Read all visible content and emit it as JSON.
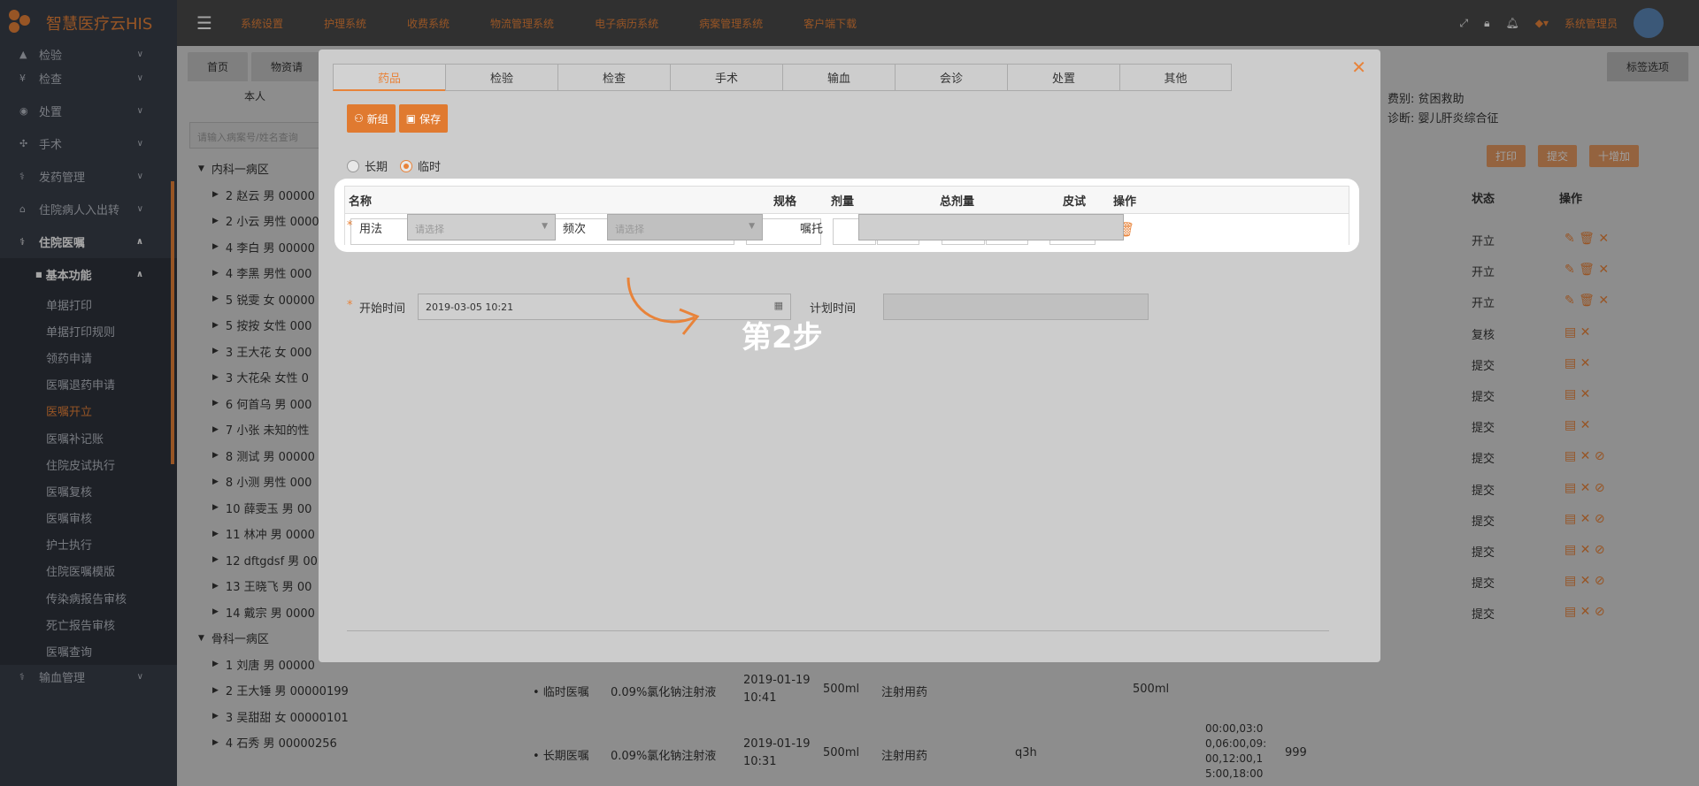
{
  "app": {
    "title": "智慧医疗云HIS"
  },
  "topnav": [
    "系统设置",
    "护理系统",
    "收费系统",
    "物流管理系统",
    "电子病历系统",
    "病案管理系统",
    "客户端下载"
  ],
  "user": {
    "name": "系统管理员"
  },
  "sidebar": {
    "items": [
      {
        "label": "检验"
      },
      {
        "label": "检查"
      },
      {
        "label": "处置"
      },
      {
        "label": "手术"
      },
      {
        "label": "发药管理"
      },
      {
        "label": "住院病人入出转"
      },
      {
        "label": "住院医嘱"
      }
    ],
    "group": "基本功能",
    "subitems": [
      "单据打印",
      "单据打印规则",
      "领药申请",
      "医嘱退药申请",
      "医嘱开立",
      "医嘱补记账",
      "住院皮试执行",
      "医嘱复核",
      "医嘱审核",
      "护士执行",
      "住院医嘱模版",
      "传染病报告审核",
      "死亡报告审核",
      "医嘱查询"
    ],
    "footer": "输血管理"
  },
  "bg": {
    "tabs": [
      "首页",
      "物资请"
    ],
    "tab_options": "标签选项",
    "self_label": "本人",
    "search_placeholder": "请输入病案号/姓名查询",
    "tree": [
      {
        "label": "内科一病区",
        "head": true
      },
      {
        "label": "2 赵云 男 00000"
      },
      {
        "label": "2 小云 男性 0000"
      },
      {
        "label": "4 李白 男 00000"
      },
      {
        "label": "4 李黑 男性 000"
      },
      {
        "label": "5 锐雯 女 00000"
      },
      {
        "label": "5 按按 女性 000"
      },
      {
        "label": "3 王大花 女 000"
      },
      {
        "label": "3 大花朵 女性 0"
      },
      {
        "label": "6 何首乌 男 000"
      },
      {
        "label": "7 小张 未知的性"
      },
      {
        "label": "8 测试 男 00000"
      },
      {
        "label": "8 小测 男性 000"
      },
      {
        "label": "10 薛雯玉 男 00"
      },
      {
        "label": "11 林冲 男 0000"
      },
      {
        "label": "12 dftgdsf 男 00"
      },
      {
        "label": "13 王晓飞 男 00"
      },
      {
        "label": "14 戴宗 男 0000"
      },
      {
        "label": "骨科一病区",
        "head": true
      },
      {
        "label": "1 刘唐 男 00000"
      },
      {
        "label": "2 王大锤 男 00000199"
      },
      {
        "label": "3 吴甜甜 女 00000101"
      },
      {
        "label": "4 石秀 男 00000256"
      }
    ],
    "info": {
      "fee_type": "费别: 贫困救助",
      "diagnosis": "诊断: 婴儿肝炎综合征"
    },
    "actions": [
      "打印",
      "提交",
      "十增加"
    ],
    "col_status": "状态",
    "col_ops": "操作",
    "statuses": [
      "开立",
      "开立",
      "开立",
      "复核",
      "提交",
      "提交",
      "提交",
      "提交",
      "提交",
      "提交",
      "提交",
      "提交",
      "提交"
    ],
    "row_a": {
      "type": "• 临时医嘱",
      "drug": "0.09%氯化钠注射液",
      "date": "2019-01-19",
      "time": "10:41",
      "amount": "500ml",
      "usage": "注射用药",
      "total": "500ml"
    },
    "row_b": {
      "type": "• 长期医嘱",
      "drug": "0.09%氯化钠注射液",
      "date": "2019-01-19",
      "time": "10:31",
      "amount": "500ml",
      "usage": "注射用药",
      "freq": "q3h",
      "schedule": "00:00,03:0 0,06:00,09: 00,12:00,1 5:00,18:00",
      "num": "999"
    }
  },
  "modal": {
    "tabs": [
      "药品",
      "检验",
      "检查",
      "手术",
      "输血",
      "会诊",
      "处置",
      "其他"
    ],
    "btn_new": "新组",
    "btn_save": "保存",
    "radio_long": "长期",
    "radio_temp": "临时",
    "table_headers": {
      "name": "名称",
      "spec": "规格",
      "dose": "剂量",
      "total": "总剂量",
      "skin": "皮试",
      "op": "操作"
    },
    "sel_placeholder": "请...",
    "usage_label": "用法",
    "usage_placeholder": "请选择",
    "freq_label": "频次",
    "freq_placeholder": "请选择",
    "advice_label": "嘱托",
    "start_label": "开始时间",
    "start_value": "2019-03-05 10:21",
    "plan_label": "计划时间",
    "step_label": "第2步"
  }
}
